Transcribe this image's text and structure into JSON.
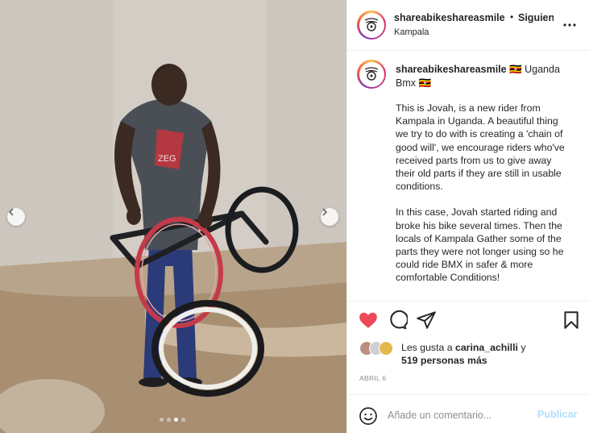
{
  "post": {
    "username": "shareabikeshareasmile",
    "separator": "•",
    "follow_label": "Siguiendo",
    "location": "Kampala",
    "more_icon": "more-horizontal-icon"
  },
  "caption": {
    "username": "shareabikeshareasmile",
    "title_suffix": "🇺🇬 Uganda Bmx 🇺🇬",
    "paragraphs": [
      "This is Jovah, is a new rider from Kampala in Uganda. A beautiful thing we try to do with is creating a 'chain of good will', we encourage riders who've received parts from us to give away their old parts if they are still in usable conditions.",
      "In this case, Jovah started riding and broke his bike several times. Then the locals of Kampala Gather some of the parts they were not longer using so he could ride BMX in safer & more comfortable Conditions!"
    ]
  },
  "actions": {
    "like_icon": "heart-filled-icon",
    "comment_icon": "comment-icon",
    "share_icon": "paper-plane-icon",
    "save_icon": "bookmark-icon",
    "like_color": "#ed4956"
  },
  "likes": {
    "prefix": "Les gusta a ",
    "user": "carina_achilli",
    "connector": " y",
    "others": "519 personas más"
  },
  "date": "ABRIL 6",
  "comment": {
    "placeholder": "Añade un comentario...",
    "publish_label": "Publicar",
    "emoji_icon": "smiley-icon",
    "publish_color": "#b2dffc"
  },
  "carousel": {
    "prev_icon": "chevron-left-icon",
    "next_icon": "chevron-right-icon",
    "total_slides": 4,
    "active_slide": 3
  }
}
